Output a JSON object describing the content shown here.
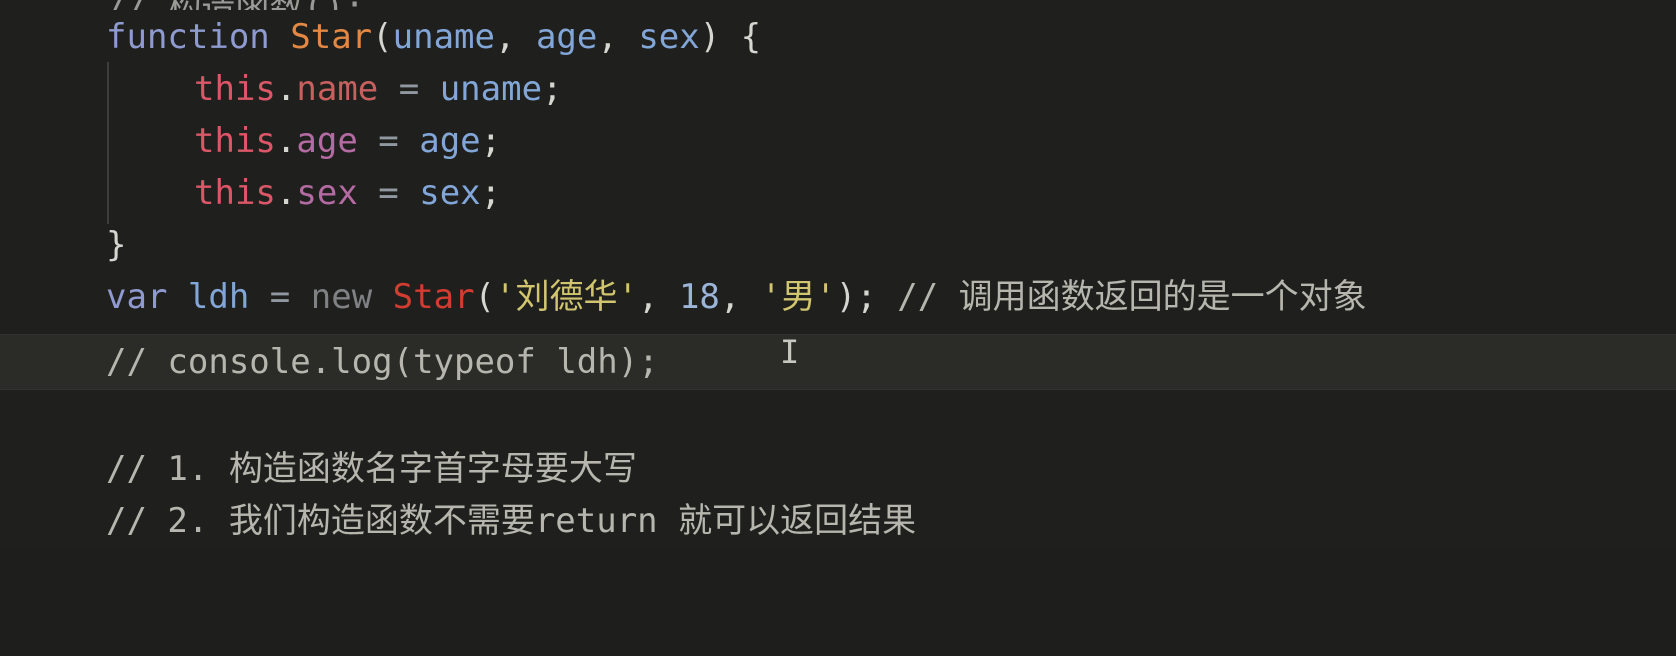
{
  "editor": {
    "top_line": "// 构造函数();",
    "line_function": {
      "kw": "function",
      "name": "Star",
      "open": "(",
      "p1": "uname",
      "comma1": ", ",
      "p2": "age",
      "comma2": ", ",
      "p3": "sex",
      "close": ") {"
    },
    "body": [
      {
        "this": "this",
        "dot": ".",
        "prop": "name",
        "eq": " = ",
        "val": "uname",
        "semi": ";"
      },
      {
        "this": "this",
        "dot": ".",
        "prop": "age",
        "eq": " = ",
        "val": "age",
        "semi": ";"
      },
      {
        "this": "this",
        "dot": ".",
        "prop": "sex",
        "eq": " = ",
        "val": "sex",
        "semi": ";"
      }
    ],
    "closing_brace": "}",
    "line_var": {
      "kw": "var",
      "name": "ldh",
      "eq": " = ",
      "new": "new",
      "ctor": "Star",
      "open": "(",
      "arg1": "'刘德华'",
      "comma1": ", ",
      "arg2": "18",
      "comma2": ", ",
      "arg3": "'男'",
      "close": ");",
      "comment": " // 调用函数返回的是一个对象"
    },
    "line_console_comment": "// console.log(typeof ldh);",
    "note1": "// 1. 构造函数名字首字母要大写",
    "note2": "// 2. 我们构造函数不需要return 就可以返回结果",
    "cursor_glyph": "I"
  }
}
